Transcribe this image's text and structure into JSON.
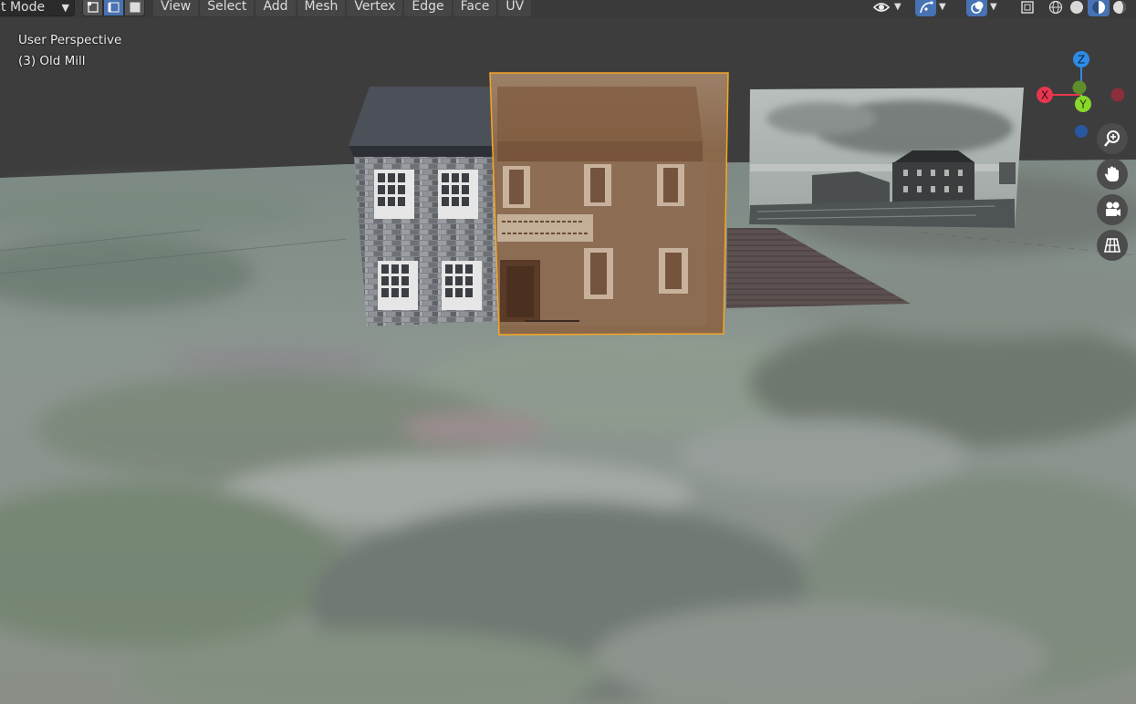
{
  "header": {
    "mode_label": "t Mode",
    "menus": [
      "View",
      "Select",
      "Add",
      "Mesh",
      "Vertex",
      "Edge",
      "Face",
      "UV"
    ],
    "select_modes": [
      "vertex-select",
      "edge-select",
      "face-select"
    ],
    "active_select_mode": "edge-select"
  },
  "viewport": {
    "perspective_label": "User Perspective",
    "object_label": "(3) Old Mill"
  },
  "gizmo": {
    "x_label": "X",
    "y_label": "Y",
    "z_label": "Z",
    "colors": {
      "x": "#e8364f",
      "y": "#8ad62c",
      "z": "#2d8ce6"
    }
  },
  "navigation": [
    "zoom-icon",
    "hand-pan-icon",
    "camera-icon",
    "grid-ortho-icon"
  ],
  "colors": {
    "accent": "#4772b3",
    "selection_outline": "#f5a623",
    "header_bg": "#3a3a3a"
  }
}
